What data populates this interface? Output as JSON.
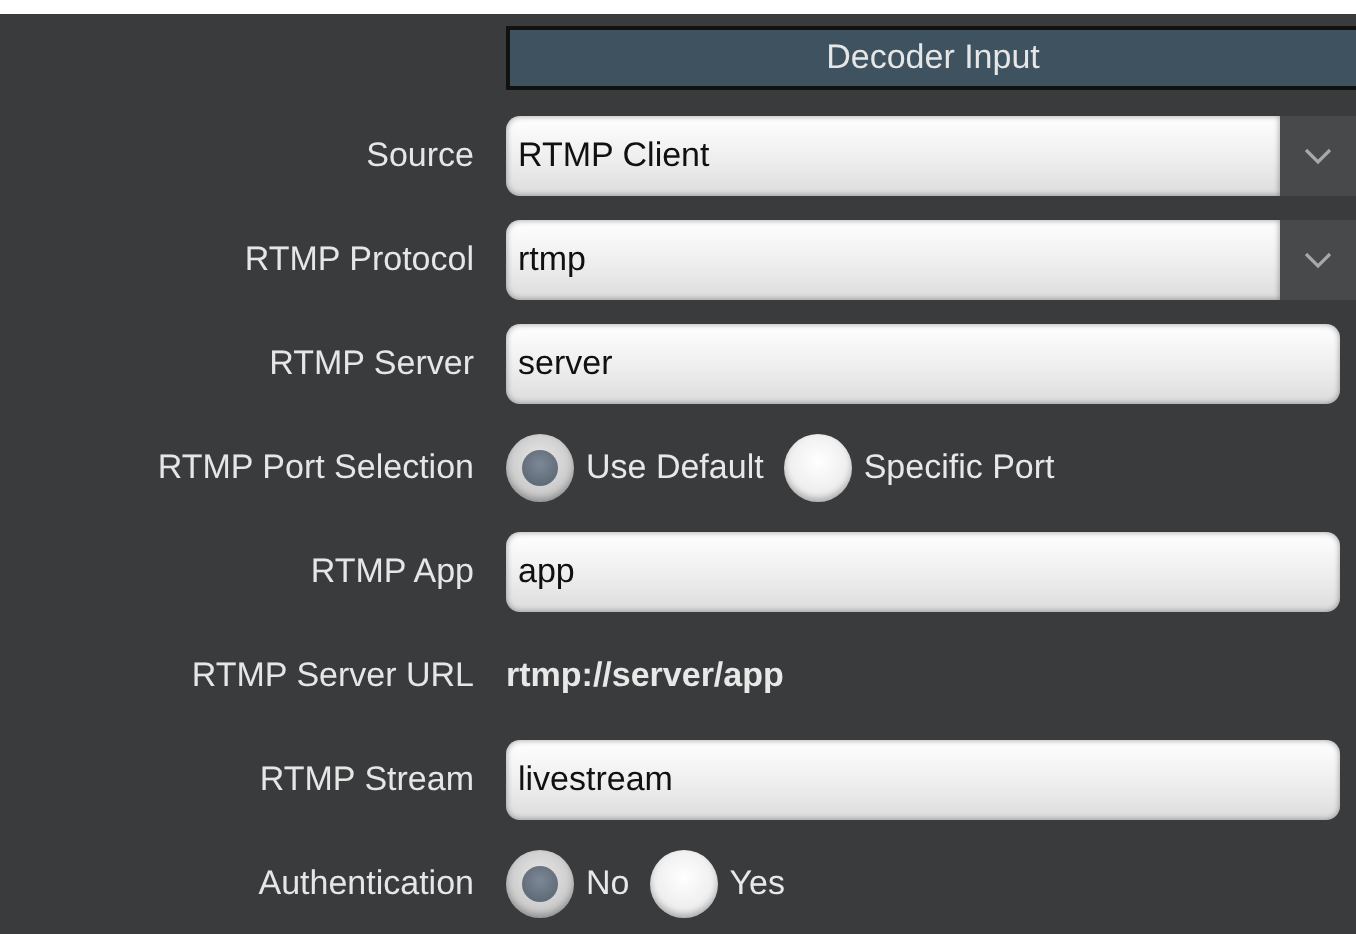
{
  "header": {
    "title": "Decoder Input"
  },
  "fields": [
    {
      "kind": "select",
      "label": "Source",
      "value": "RTMP Client"
    },
    {
      "kind": "select",
      "label": "RTMP Protocol",
      "value": "rtmp"
    },
    {
      "kind": "text",
      "label": "RTMP Server",
      "value": "server"
    },
    {
      "kind": "radio",
      "label": "RTMP Port Selection",
      "options": [
        {
          "label": "Use Default",
          "selected": true
        },
        {
          "label": "Specific Port",
          "selected": false
        }
      ]
    },
    {
      "kind": "text",
      "label": "RTMP App",
      "value": "app"
    },
    {
      "kind": "readout",
      "label": "RTMP Server URL",
      "value": "rtmp://server/app"
    },
    {
      "kind": "text",
      "label": "RTMP Stream",
      "value": "livestream"
    },
    {
      "kind": "radio",
      "label": "Authentication",
      "options": [
        {
          "label": "No",
          "selected": true
        },
        {
          "label": "Yes",
          "selected": false
        }
      ]
    }
  ]
}
